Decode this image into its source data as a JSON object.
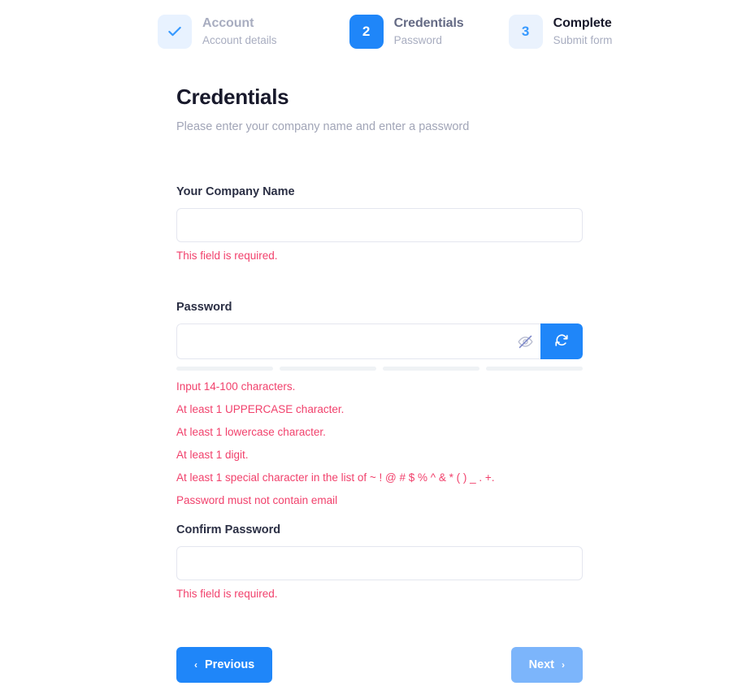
{
  "stepper": {
    "steps": [
      {
        "badge_icon": "check-icon",
        "badge_text": "",
        "title": "Account",
        "subtitle": "Account details",
        "state": "done"
      },
      {
        "badge_icon": "",
        "badge_text": "2",
        "title": "Credentials",
        "subtitle": "Password",
        "state": "active"
      },
      {
        "badge_icon": "",
        "badge_text": "3",
        "title": "Complete",
        "subtitle": "Submit form",
        "state": "todo"
      }
    ]
  },
  "form": {
    "title": "Credentials",
    "description": "Please enter your company name and enter a password",
    "company": {
      "label": "Your Company Name",
      "value": "",
      "placeholder": "",
      "error": "This field is required."
    },
    "password": {
      "label": "Password",
      "value": "",
      "placeholder": "",
      "toggle_icon": "eye-slash-icon",
      "generate_icon": "refresh-icon",
      "strength_segments": [
        0,
        0,
        0,
        0
      ],
      "rules": [
        "Input 14-100 characters.",
        "At least 1 UPPERCASE character.",
        "At least 1 lowercase character.",
        "At least 1 digit.",
        "At least 1 special character in the list of ~ ! @ # $ % ^ & * ( ) _ . +.",
        "Password must not contain email"
      ]
    },
    "confirm": {
      "label": "Confirm Password",
      "value": "",
      "placeholder": "",
      "error": "This field is required."
    }
  },
  "nav": {
    "previous_label": "Previous",
    "previous_icon": "chevron-left-icon",
    "next_label": "Next",
    "next_icon": "chevron-right-icon"
  },
  "colors": {
    "accent": "#1f86f9",
    "accent_soft": "#7cb5fb",
    "badge_soft_bg": "#e8f2ff",
    "error": "#f1416c",
    "border": "#e4e6ef",
    "muted_text": "#a1a5b7",
    "heading": "#18192b",
    "meter_empty": "#eff2f5"
  }
}
